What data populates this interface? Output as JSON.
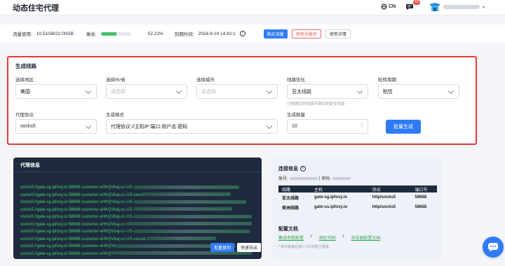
{
  "header": {
    "title": "动态住宅代理",
    "lang_label": "CN",
    "message_badge": "18"
  },
  "usage": {
    "traffic_label": "流量使用:",
    "traffic_value": "10.51GB/22.00GB",
    "remaining_label": "剩余:",
    "remaining_fraction": 0.5222,
    "remaining_percent": "52.22%",
    "expiry_label": "到期时间:",
    "expiry_value": "2024-9-19 14:42:1",
    "buy_label": "购买流量",
    "use_coupon_label": "使用流量券",
    "details_label": "使用详情"
  },
  "generate": {
    "title": "生成线路",
    "region_label": "选择地区",
    "region_value": "美国",
    "state_label": "选择州/省",
    "state_placeholder": "请选择",
    "city_label": "选择城市",
    "city_placeholder": "请选择",
    "route_label": "线路优化",
    "route_value": "亚太线路",
    "route_hint": "已根据您的网络环境匹配最佳线路",
    "rotation_label": "轮转周期",
    "rotation_value": "粘性",
    "protocol_label": "代理协议",
    "protocol_value": "socks5",
    "format_label": "生成格式",
    "format_value": "代理协议://主机IP:端口:用户名:密码",
    "count_label": "生成数量",
    "count_value": "10",
    "generate_button": "批量生成"
  },
  "proxy_info": {
    "title": "代理信息",
    "lines": [
      "socks5://gate-sg.ipfoxy.io:58688:customer-eHhQVbaj-cc-US-",
      "socks5://gate-sg.ipfoxy.io:58688:customer-eHhQVbaj-cc-US-sessi",
      "socks5://gate-sg.ipfoxy.io:58688:customer-eHhQVbaj-cc-US-",
      "socks5://gate-sg.ipfoxy.io:58688:customer-eHhQVbaj-cc-US-",
      "socks5://gate-sg.ipfoxy.io:58688:customer-eHhQVbaj-cc-US-",
      "socks5://gate-sg.ipfoxy.io:58688:customer-eHhQVbaj-cc-",
      "socks5://gate-sg.ipfoxy.io:58688:customer-eHhQVbaj-cc-US-",
      "socks5://gate-sg.ipfoxy.io:58688:customer-eHhQVbaj-cc-US-sessid-1",
      "socks5://gate-sg.ipfoxy.io:58688:customer-eHhQVb",
      "socks5://gate-sg.ipfoxy.io:58688:customer-eHhQ"
    ],
    "copy_button": "批量复制",
    "export_button": "快速导出"
  },
  "connection": {
    "title": "连接信息",
    "account_label": "账号:",
    "password_label": "密码:",
    "columns": [
      "线路",
      "主机",
      "协议",
      "端口号"
    ],
    "rows": [
      [
        "亚太线路",
        "gate-sg.ipfoxy.io",
        "http/socks5",
        "58688"
      ],
      [
        "美洲线路",
        "gate-us.ipfoxy.io",
        "http/socks5",
        "58688"
      ]
    ],
    "docs_title": "配置文档",
    "doc_links": [
      "集成参数配置",
      "地区代码",
      "浏览器配置文档"
    ],
    "note": "* 购买套餐后第1~3分钟建立链接"
  },
  "colors": {
    "accent": "#2f7bf6",
    "panel_dark": "#1e2a3e",
    "proxy_text": "#45d36c",
    "highlight": "#e33b3b",
    "progress": "#47c16d"
  }
}
